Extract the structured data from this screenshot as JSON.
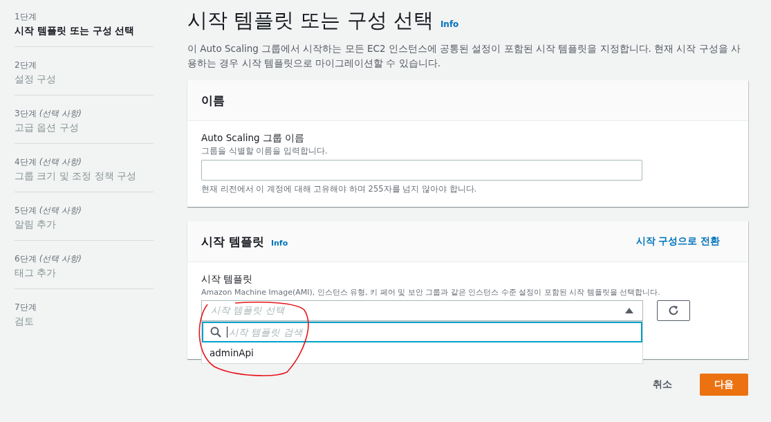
{
  "steps": [
    {
      "step": "1단계",
      "title": "시작 템플릿 또는 구성 선택",
      "selected": true
    },
    {
      "step": "2단계",
      "title": "설정 구성",
      "selected": false
    },
    {
      "step": "3단계",
      "note": "(선택 사항)",
      "title": "고급 옵션 구성",
      "selected": false
    },
    {
      "step": "4단계",
      "note": "(선택 사항)",
      "title": "그룹 크기 및 조정 정책 구성",
      "selected": false
    },
    {
      "step": "5단계",
      "note": "(선택 사항)",
      "title": "알림 추가",
      "selected": false
    },
    {
      "step": "6단계",
      "note": "(선택 사항)",
      "title": "태그 추가",
      "selected": false
    },
    {
      "step": "7단계",
      "title": "검토",
      "selected": false
    }
  ],
  "page": {
    "title": "시작 템플릿 또는 구성 선택",
    "info": "Info",
    "description": "이 Auto Scaling 그룹에서 시작하는 모든 EC2 인스턴스에 공통된 설정이 포함된 시작 템플릿을 지정합니다. 현재 시작 구성을 사용하는 경우 시작 템플릿으로 마이그레이션할 수 있습니다."
  },
  "name_card": {
    "title": "이름",
    "label": "Auto Scaling 그룹 이름",
    "hint": "그룹을 식별할 이름을 입력합니다.",
    "constraint": "현재 리전에서 이 계정에 대해 고유해야 하며 255자를 넘지 않아야 합니다."
  },
  "template_card": {
    "title": "시작 템플릿",
    "info": "Info",
    "switch_link": "시작 구성으로 전환",
    "label": "시작 템플릿",
    "hint": "Amazon Machine Image(AMI), 인스턴스 유형, 키 페어 및 보안 그룹과 같은 인스턴스 수준 설정이 포함된 시작 템플릿을 선택합니다.",
    "select": {
      "placeholder": "시작 템플릿 선택",
      "expanded": true
    },
    "search": {
      "placeholder": "시작 템플릿 검색"
    },
    "options": [
      {
        "label": "adminApi",
        "selected": false
      }
    ]
  },
  "buttons": {
    "cancel": "취소",
    "next": "다음"
  }
}
